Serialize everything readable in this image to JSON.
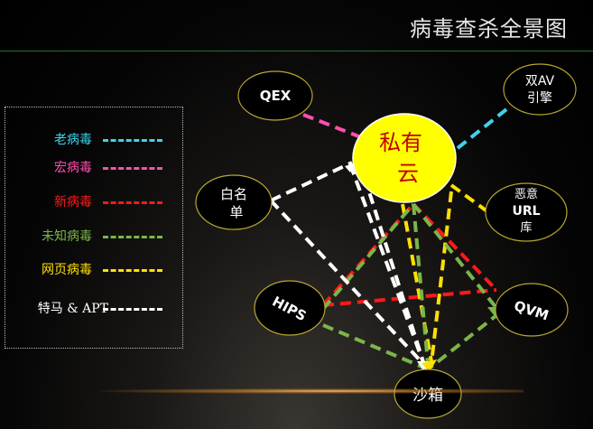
{
  "title": "病毒查杀全景图",
  "legend": [
    {
      "label": "老病毒",
      "color": "#3fd2ea"
    },
    {
      "label": "宏病毒",
      "color": "#ff4fb0"
    },
    {
      "label": "新病毒",
      "color": "#ff1a1a"
    },
    {
      "label": "未知病毒",
      "color": "#7ab648"
    },
    {
      "label": "网页病毒",
      "color": "#ffe000"
    },
    {
      "label": "特马 & APT",
      "color": "#ffffff"
    }
  ],
  "nodes": {
    "qex": {
      "line1": "QEX"
    },
    "av": {
      "line1": "双AV",
      "line2": "引擎"
    },
    "cloud": {
      "line1": "私有",
      "line2": "云"
    },
    "whitelist": {
      "line1": "白名",
      "line2": "单"
    },
    "url": {
      "line1": "恶意",
      "line2": "URL",
      "line3": "库"
    },
    "hips": {
      "line1": "HIPS"
    },
    "qvm": {
      "line1": "QVM"
    },
    "sandbox": {
      "line1": "沙箱"
    }
  }
}
